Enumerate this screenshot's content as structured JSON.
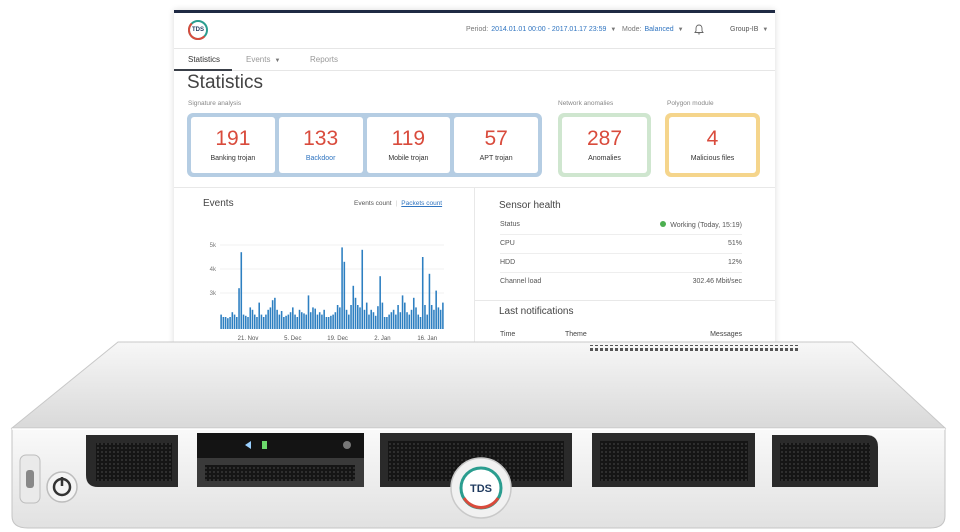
{
  "header": {
    "logo_text": "TDS",
    "period_label": "Period:",
    "period_value": "2014.01.01 00:00 - 2017.01.17 23:59",
    "mode_label": "Mode:",
    "mode_value": "Balanced",
    "group": "Group-IB"
  },
  "tabs": [
    "Statistics",
    "Events",
    "Reports"
  ],
  "page_title": "Statistics",
  "sections": {
    "signature": {
      "label": "Signature analysis",
      "items": [
        {
          "value": "191",
          "label": "Banking trojan"
        },
        {
          "value": "133",
          "label": "Backdoor"
        },
        {
          "value": "119",
          "label": "Mobile trojan"
        },
        {
          "value": "57",
          "label": "APT trojan"
        }
      ]
    },
    "network": {
      "label": "Network anomalies",
      "value": "287",
      "label_item": "Anomalies"
    },
    "polygon": {
      "label": "Polygon module",
      "value": "4",
      "label_item": "Malicious files"
    }
  },
  "events": {
    "title": "Events",
    "toggle_count": "Events count",
    "toggle_packets": "Packets count"
  },
  "sensor_health": {
    "title": "Sensor health",
    "rows": [
      {
        "key": "Status",
        "value": "Working (Today, 15:19)"
      },
      {
        "key": "CPU",
        "value": "51%"
      },
      {
        "key": "HDD",
        "value": "12%"
      },
      {
        "key": "Channel load",
        "value": "302.46 Mbit/sec"
      }
    ]
  },
  "notifications": {
    "title": "Last notifications",
    "columns": [
      "Time",
      "Theme",
      "Messages"
    ]
  },
  "device": {
    "logo_text": "TDS"
  },
  "colors": {
    "accent": "#2f74c0",
    "stat_number": "#d94b3c",
    "bar": "#2d7fc1",
    "status_ok": "#4caf50"
  },
  "chart_data": {
    "type": "bar",
    "title": "Events",
    "ylim": [
      1500,
      5500
    ],
    "yticks": [
      {
        "value": 3000,
        "label": "3k"
      },
      {
        "value": 4000,
        "label": "4k"
      },
      {
        "value": 5000,
        "label": "5k"
      }
    ],
    "xticks": [
      {
        "index": 12,
        "label": "21. Nov"
      },
      {
        "index": 32,
        "label": "5. Dec"
      },
      {
        "index": 52,
        "label": "19. Dec"
      },
      {
        "index": 72,
        "label": "2. Jan"
      },
      {
        "index": 92,
        "label": "16. Jan"
      }
    ],
    "values": [
      2100,
      2000,
      2000,
      1950,
      2000,
      2200,
      2100,
      2000,
      3200,
      4700,
      2100,
      2050,
      2000,
      2400,
      2300,
      2100,
      2000,
      2600,
      2100,
      2000,
      2100,
      2300,
      2400,
      2700,
      2800,
      2300,
      2100,
      2250,
      2000,
      2050,
      2100,
      2200,
      2400,
      2100,
      2000,
      2300,
      2200,
      2150,
      2100,
      2900,
      2200,
      2400,
      2350,
      2100,
      2200,
      2100,
      2300,
      2000,
      2000,
      2050,
      2100,
      2200,
      2500,
      2400,
      4900,
      4300,
      2300,
      2100,
      2500,
      3300,
      2800,
      2500,
      2400,
      4800,
      2300,
      2600,
      2100,
      2300,
      2200,
      2050,
      2450,
      3700,
      2600,
      2000,
      2000,
      2100,
      2200,
      2300,
      2100,
      2500,
      2200,
      2900,
      2600,
      2200,
      2100,
      2300,
      2800,
      2400,
      2100,
      2000,
      4500,
      2500,
      2100,
      3800,
      2500,
      2300,
      3100,
      2400,
      2300,
      2600
    ]
  }
}
